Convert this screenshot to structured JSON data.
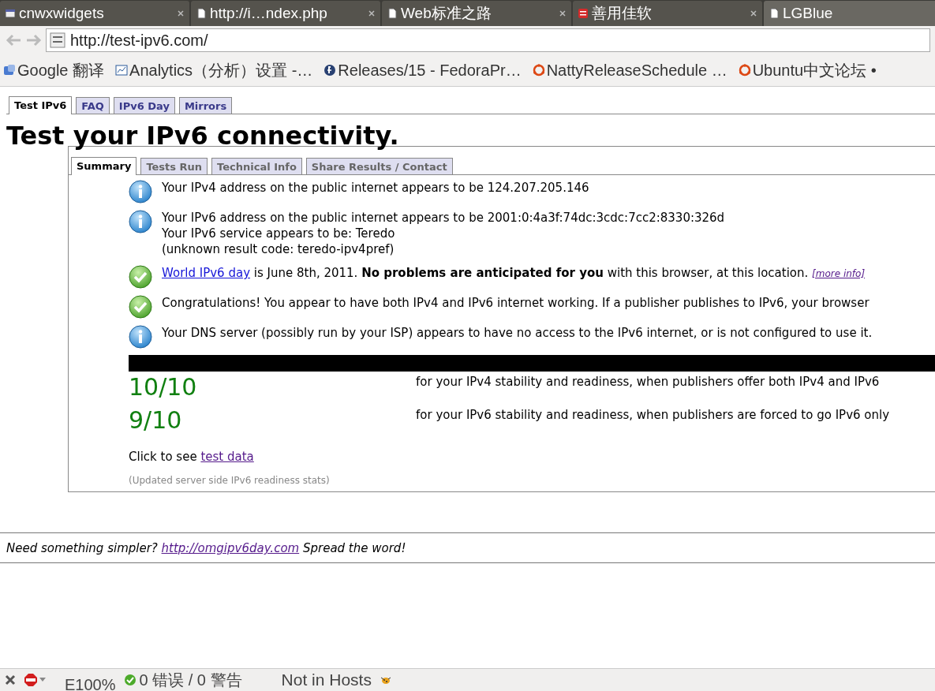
{
  "browser_tabs": [
    {
      "title": "cnwxwidgets",
      "kind": "window",
      "selected": false
    },
    {
      "title": "http://i…ndex.php",
      "kind": "page",
      "selected": false
    },
    {
      "title": "Web标准之路",
      "kind": "page",
      "selected": false
    },
    {
      "title": "善用佳软",
      "kind": "logo",
      "selected": false
    },
    {
      "title": "LGBlue",
      "kind": "page",
      "selected": true
    }
  ],
  "address_bar": {
    "url": "http://test-ipv6.com/"
  },
  "bookmarks": [
    {
      "label": "Google 翻译",
      "kind": "translate"
    },
    {
      "label": "Analytics（分析）设置 -…",
      "kind": "chart"
    },
    {
      "label": "Releases/15 - FedoraPr…",
      "kind": "circle-f"
    },
    {
      "label": "NattyReleaseSchedule …",
      "kind": "ring"
    },
    {
      "label": "Ubuntu中文论坛 •",
      "kind": "ring"
    }
  ],
  "site_tabs": [
    {
      "label": "Test IPv6",
      "selected": true
    },
    {
      "label": "FAQ",
      "selected": false
    },
    {
      "label": "IPv6 Day",
      "selected": false
    },
    {
      "label": "Mirrors",
      "selected": false
    }
  ],
  "heading": "Test your IPv6 connectivity.",
  "panel_tabs": [
    {
      "label": "Summary",
      "selected": true
    },
    {
      "label": "Tests Run",
      "selected": false
    },
    {
      "label": "Technical Info",
      "selected": false
    },
    {
      "label": "Share Results / Contact",
      "selected": false
    }
  ],
  "messages": [
    {
      "kind": "info",
      "lines": [
        [
          {
            "kind": "text",
            "text": "Your IPv4 address on the public internet appears to be 124.207.205.146"
          }
        ]
      ]
    },
    {
      "kind": "info",
      "lines": [
        [
          {
            "kind": "text",
            "text": "Your IPv6 address on the public internet appears to be 2001:0:4a3f:74dc:3cdc:7cc2:8330:326d"
          }
        ],
        [
          {
            "kind": "text",
            "text": "Your IPv6 service appears to be: Teredo"
          }
        ]
      ]
    },
    {
      "kind": "none",
      "lines": [
        [
          {
            "kind": "text",
            "text": "(unknown result code: teredo-ipv4pref)"
          }
        ]
      ]
    },
    {
      "kind": "ok",
      "lines": [
        [
          {
            "kind": "link",
            "text": "World IPv6 day"
          },
          {
            "kind": "text",
            "text": " is June 8th, 2011. **No problems are anticipated for you** with this browser, at this location. "
          },
          {
            "kind": "small-link",
            "text": "[more info]"
          }
        ]
      ]
    },
    {
      "kind": "ok",
      "lines": [
        [
          {
            "kind": "text",
            "text": "Congratulations! You appear to have both IPv4 and IPv6 internet working. If a publisher publishes to IPv6, your browser"
          }
        ]
      ]
    },
    {
      "kind": "info",
      "lines": [
        [
          {
            "kind": "text",
            "text": "Your DNS server (possibly run by your ISP) appears to have no access to the IPv6 internet, or is not configured to use it."
          }
        ]
      ]
    }
  ],
  "scores": [
    {
      "score": "10/10",
      "description": "for your IPv4 stability and readiness, when publishers offer both IPv4 and IPv6"
    },
    {
      "score": "9/10",
      "description": "for your IPv6 stability and readiness, when publishers are forced to go IPv6 only"
    }
  ],
  "test_data": {
    "prefix": "Click to see ",
    "link": "test data"
  },
  "stats_note": "(Updated server side IPv6 readiness stats)",
  "footer": {
    "prefix": "Need something simpler? ",
    "link": "http://omgipv6day.com",
    "suffix": " Spread the word!"
  },
  "status_bar": {
    "zoom": "E100%",
    "errors": "0 错误 / 0 警告",
    "hosts": "Not in Hosts"
  }
}
